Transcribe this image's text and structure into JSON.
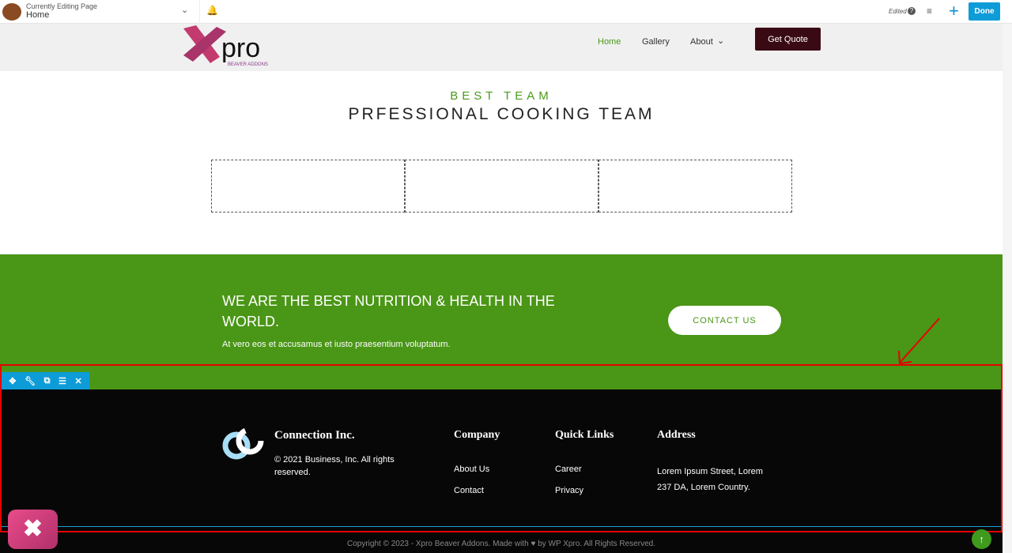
{
  "topbar": {
    "editing_label": "Currently Editing Page",
    "page": "Home",
    "edited": "Edited",
    "done": "Done"
  },
  "header": {
    "nav": [
      "Home",
      "Gallery",
      "About"
    ],
    "get_quote": "Get Quote",
    "logo_sub": "BEAVER ADDONS",
    "active_color": "#4a9a1a"
  },
  "team": {
    "subtitle": "BEST TEAM",
    "title": "PRFESSIONAL COOKING TEAM"
  },
  "cta": {
    "title": "WE ARE THE BEST NUTRITION & HEALTH IN THE WORLD.",
    "text": "At vero eos et accusamus et iusto praesentium voluptatum.",
    "button": "CONTACT US",
    "color": "#4a9616"
  },
  "footer": {
    "brand": "Connection Inc.",
    "brand_text": "© 2021 Business, Inc. All rights reserved.",
    "company": {
      "title": "Company",
      "links": [
        "About Us",
        "Contact"
      ]
    },
    "quick": {
      "title": "Quick Links",
      "links": [
        "Career",
        "Privacy"
      ]
    },
    "address": {
      "title": "Address",
      "line1": "Lorem Ipsum Street, Lorem",
      "line2": "237 DA, Lorem Country."
    },
    "copyright": "Copyright © 2023 - Xpro Beaver Addons. Made with ♥ by WP Xpro. All Rights Reserved."
  }
}
